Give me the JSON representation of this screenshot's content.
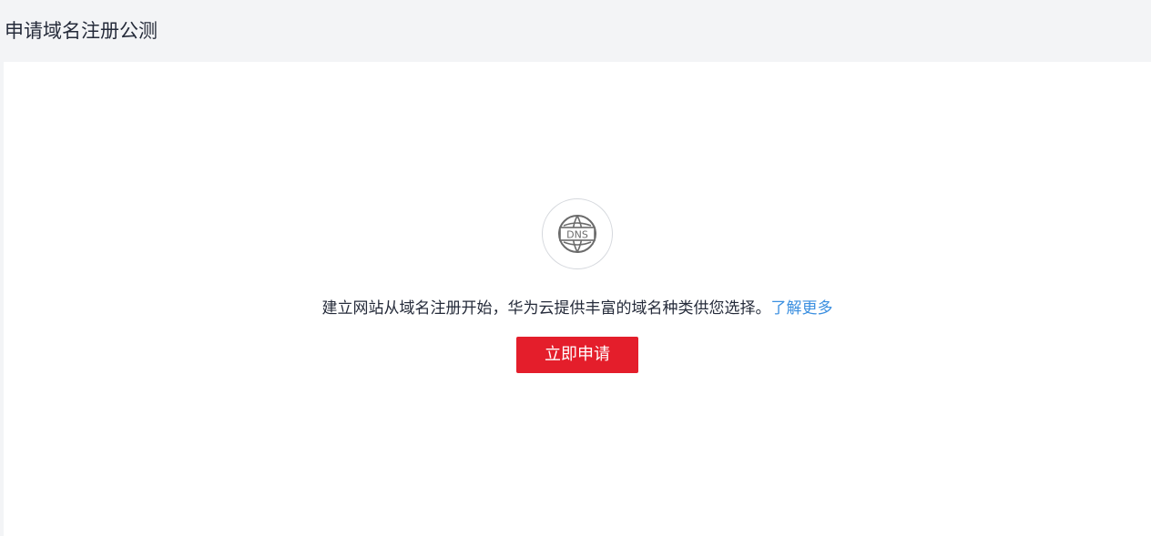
{
  "header": {
    "title": "申请域名注册公测"
  },
  "empty_state": {
    "icon": "dns-globe-icon",
    "icon_text": "DNS",
    "description": "建立网站从域名注册开始，华为云提供丰富的域名种类供您选择。",
    "learn_more_label": "了解更多",
    "apply_button_label": "立即申请"
  },
  "colors": {
    "page_background": "#f3f4f6",
    "panel_background": "#ffffff",
    "link": "#3b8fe0",
    "primary_button": "#e41e2b"
  }
}
